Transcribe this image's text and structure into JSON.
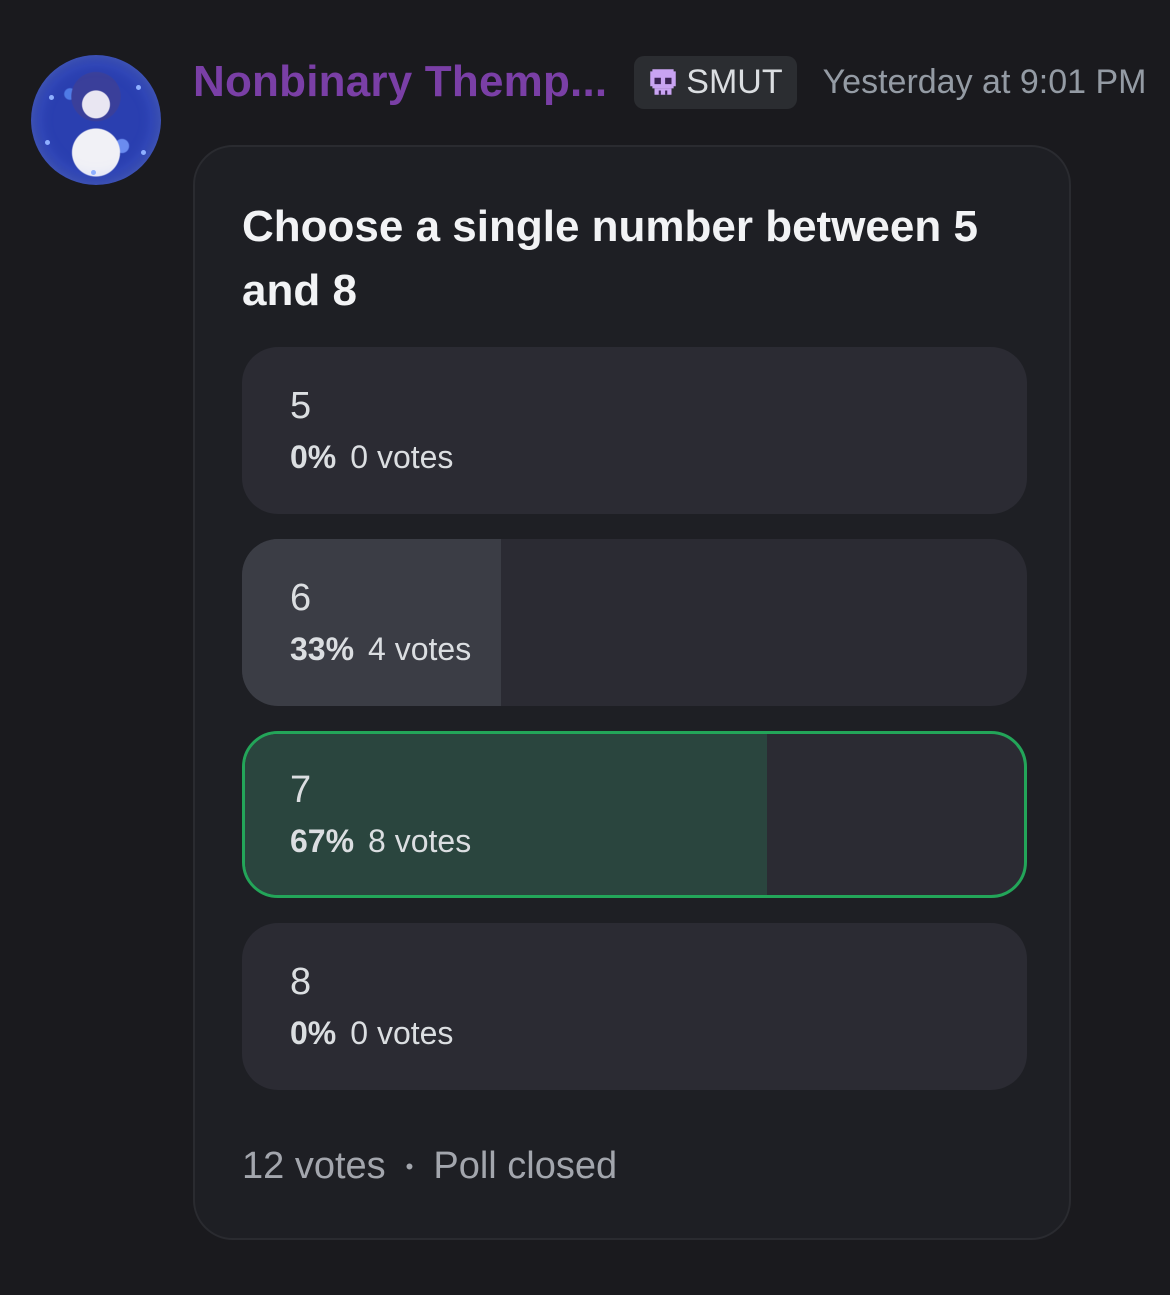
{
  "message": {
    "username": "Nonbinary Themp...",
    "role_tag": {
      "icon": "skull-icon",
      "label": "SMUT"
    },
    "timestamp": "Yesterday at 9:01 PM"
  },
  "poll": {
    "question": "Choose a single number between 5 and 8",
    "answers": [
      {
        "label": "5",
        "percent": "0%",
        "votes": "0 votes",
        "fraction": 0,
        "chosen": false
      },
      {
        "label": "6",
        "percent": "33%",
        "votes": "4 votes",
        "fraction": 0.33,
        "chosen": false
      },
      {
        "label": "7",
        "percent": "67%",
        "votes": "8 votes",
        "fraction": 0.67,
        "chosen": true
      },
      {
        "label": "8",
        "percent": "0%",
        "votes": "0 votes",
        "fraction": 0,
        "chosen": false
      }
    ],
    "total_votes": "12 votes",
    "separator": "•",
    "status": "Poll closed"
  },
  "colors": {
    "username": "#7a3fa6",
    "chosen_border": "#23a559",
    "chosen_fill": "#2a453e"
  }
}
